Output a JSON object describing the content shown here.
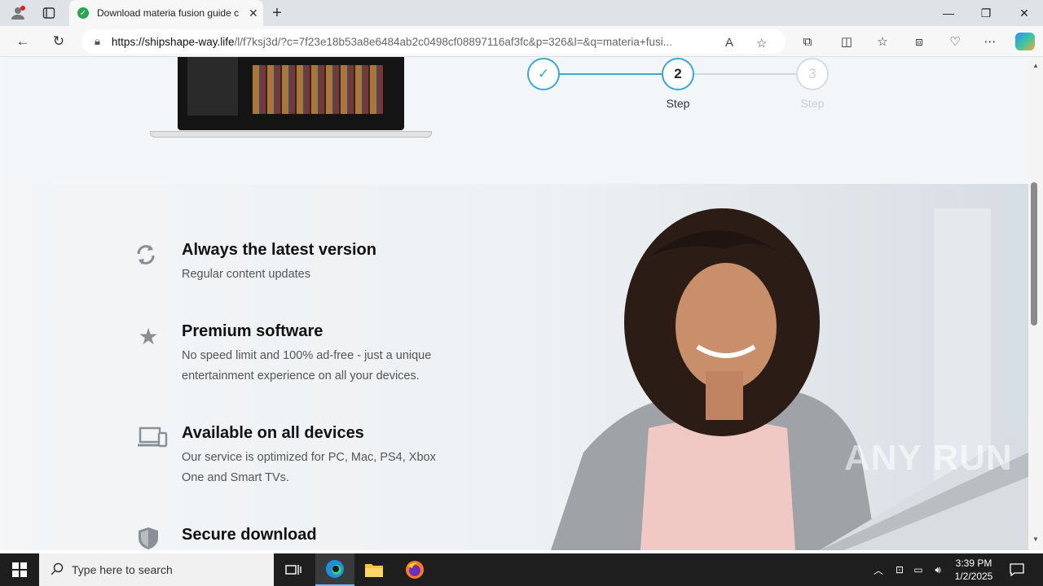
{
  "browser": {
    "tab_title": "Download materia fusion guide c",
    "url_host": "https://shipshape-way.life",
    "url_rest": "/l/f7ksj3d/?c=7f23e18b53a8e6484ab2c0498cf08897116af3fc&p=326&l=&q=materia+fusi..."
  },
  "steps": [
    {
      "label": "",
      "state": "done"
    },
    {
      "number": "2",
      "label": "Step",
      "state": "active"
    },
    {
      "number": "3",
      "label": "Step",
      "state": "pending"
    }
  ],
  "features": [
    {
      "icon": "refresh-icon",
      "title": "Always the latest version",
      "desc": "Regular content updates"
    },
    {
      "icon": "star-icon",
      "title": "Premium software",
      "desc": "No speed limit and 100% ad-free - just a unique entertainment experience on all your devices."
    },
    {
      "icon": "devices-icon",
      "title": "Available on all devices",
      "desc": "Our service is optimized for PC, Mac, PS4, Xbox One and Smart TVs."
    },
    {
      "icon": "shield-icon",
      "title": "Secure download",
      "desc": ""
    }
  ],
  "watermark": "ANY RUN",
  "taskbar": {
    "search_placeholder": "Type here to search",
    "time": "3:39 PM",
    "date": "1/2/2025"
  },
  "colors": {
    "accent": "#3aa7d9",
    "taskbar": "#1e1e1e"
  }
}
